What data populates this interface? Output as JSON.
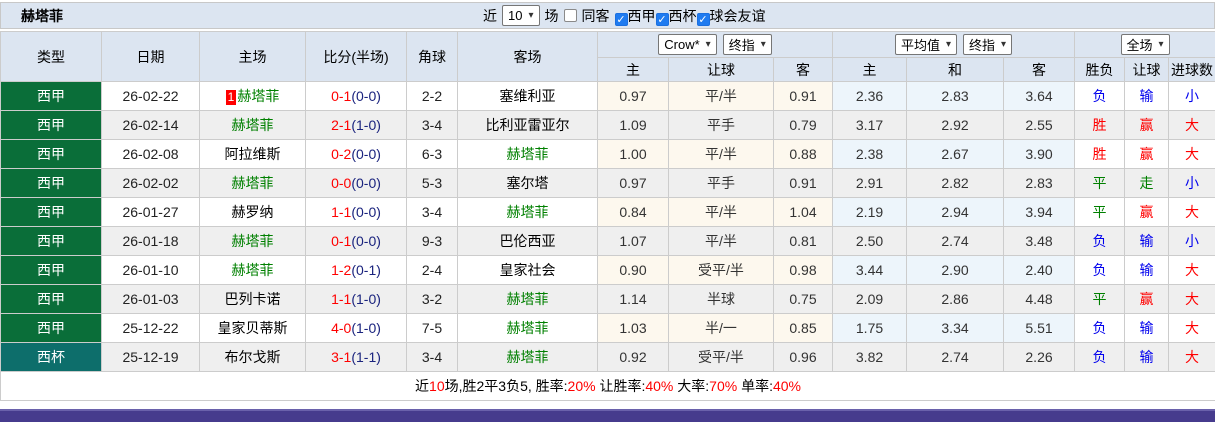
{
  "title": "赫塔菲",
  "toolbar": {
    "near_label": "近",
    "matches_count": "10",
    "matches_label": "场",
    "same_venue_label": "同客",
    "same_venue_checked": false,
    "filters": [
      {
        "label": "西甲",
        "checked": true
      },
      {
        "label": "西杯",
        "checked": true
      },
      {
        "label": "球会友谊",
        "checked": true
      }
    ]
  },
  "header": {
    "static_cols": [
      "类型",
      "日期",
      "主场",
      "比分(半场)",
      "角球",
      "客场"
    ],
    "group1_selects": [
      "Crow*",
      "终指"
    ],
    "group2_selects": [
      "平均值",
      "终指"
    ],
    "group3_selects": [
      "全场"
    ],
    "sub_cols": [
      "主",
      "让球",
      "客",
      "主",
      "和",
      "客",
      "胜负",
      "让球",
      "进球数"
    ]
  },
  "rows": [
    {
      "league": "西甲",
      "league_color": "green",
      "date": "26-02-22",
      "home": "赫塔菲",
      "home_focus": true,
      "home_badge": "1",
      "score": "0-1",
      "half": "(0-0)",
      "corner": "2-2",
      "away": "塞维利亚",
      "away_focus": false,
      "odds": [
        "0.97",
        "平/半",
        "0.91"
      ],
      "avg": [
        "2.36",
        "2.83",
        "3.64"
      ],
      "results": [
        {
          "text": "负",
          "color": "blue"
        },
        {
          "text": "输",
          "color": "blue"
        },
        {
          "text": "小",
          "color": "blue"
        }
      ]
    },
    {
      "league": "西甲",
      "league_color": "green",
      "date": "26-02-14",
      "home": "赫塔菲",
      "home_focus": true,
      "home_badge": "",
      "score": "2-1",
      "half": "(1-0)",
      "corner": "3-4",
      "away": "比利亚雷亚尔",
      "away_focus": false,
      "odds": [
        "1.09",
        "平手",
        "0.79"
      ],
      "avg": [
        "3.17",
        "2.92",
        "2.55"
      ],
      "results": [
        {
          "text": "胜",
          "color": "red"
        },
        {
          "text": "赢",
          "color": "red"
        },
        {
          "text": "大",
          "color": "red"
        }
      ]
    },
    {
      "league": "西甲",
      "league_color": "green",
      "date": "26-02-08",
      "home": "阿拉维斯",
      "home_focus": false,
      "home_badge": "",
      "score": "0-2",
      "half": "(0-0)",
      "corner": "6-3",
      "away": "赫塔菲",
      "away_focus": true,
      "odds": [
        "1.00",
        "平/半",
        "0.88"
      ],
      "avg": [
        "2.38",
        "2.67",
        "3.90"
      ],
      "results": [
        {
          "text": "胜",
          "color": "red"
        },
        {
          "text": "赢",
          "color": "red"
        },
        {
          "text": "大",
          "color": "red"
        }
      ]
    },
    {
      "league": "西甲",
      "league_color": "green",
      "date": "26-02-02",
      "home": "赫塔菲",
      "home_focus": true,
      "home_badge": "",
      "score": "0-0",
      "half": "(0-0)",
      "corner": "5-3",
      "away": "塞尔塔",
      "away_focus": false,
      "odds": [
        "0.97",
        "平手",
        "0.91"
      ],
      "avg": [
        "2.91",
        "2.82",
        "2.83"
      ],
      "results": [
        {
          "text": "平",
          "color": "green"
        },
        {
          "text": "走",
          "color": "green"
        },
        {
          "text": "小",
          "color": "blue"
        }
      ]
    },
    {
      "league": "西甲",
      "league_color": "green",
      "date": "26-01-27",
      "home": "赫罗纳",
      "home_focus": false,
      "home_badge": "",
      "score": "1-1",
      "half": "(0-0)",
      "corner": "3-4",
      "away": "赫塔菲",
      "away_focus": true,
      "odds": [
        "0.84",
        "平/半",
        "1.04"
      ],
      "avg": [
        "2.19",
        "2.94",
        "3.94"
      ],
      "results": [
        {
          "text": "平",
          "color": "green"
        },
        {
          "text": "赢",
          "color": "red"
        },
        {
          "text": "大",
          "color": "red"
        }
      ]
    },
    {
      "league": "西甲",
      "league_color": "green",
      "date": "26-01-18",
      "home": "赫塔菲",
      "home_focus": true,
      "home_badge": "",
      "score": "0-1",
      "half": "(0-0)",
      "corner": "9-3",
      "away": "巴伦西亚",
      "away_focus": false,
      "odds": [
        "1.07",
        "平/半",
        "0.81"
      ],
      "avg": [
        "2.50",
        "2.74",
        "3.48"
      ],
      "results": [
        {
          "text": "负",
          "color": "blue"
        },
        {
          "text": "输",
          "color": "blue"
        },
        {
          "text": "小",
          "color": "blue"
        }
      ]
    },
    {
      "league": "西甲",
      "league_color": "green",
      "date": "26-01-10",
      "home": "赫塔菲",
      "home_focus": true,
      "home_badge": "",
      "score": "1-2",
      "half": "(0-1)",
      "corner": "2-4",
      "away": "皇家社会",
      "away_focus": false,
      "odds": [
        "0.90",
        "受平/半",
        "0.98"
      ],
      "avg": [
        "3.44",
        "2.90",
        "2.40"
      ],
      "results": [
        {
          "text": "负",
          "color": "blue"
        },
        {
          "text": "输",
          "color": "blue"
        },
        {
          "text": "大",
          "color": "red"
        }
      ]
    },
    {
      "league": "西甲",
      "league_color": "green",
      "date": "26-01-03",
      "home": "巴列卡诺",
      "home_focus": false,
      "home_badge": "",
      "score": "1-1",
      "half": "(1-0)",
      "corner": "3-2",
      "away": "赫塔菲",
      "away_focus": true,
      "odds": [
        "1.14",
        "半球",
        "0.75"
      ],
      "avg": [
        "2.09",
        "2.86",
        "4.48"
      ],
      "results": [
        {
          "text": "平",
          "color": "green"
        },
        {
          "text": "赢",
          "color": "red"
        },
        {
          "text": "大",
          "color": "red"
        }
      ]
    },
    {
      "league": "西甲",
      "league_color": "green",
      "date": "25-12-22",
      "home": "皇家贝蒂斯",
      "home_focus": false,
      "home_badge": "",
      "score": "4-0",
      "half": "(1-0)",
      "corner": "7-5",
      "away": "赫塔菲",
      "away_focus": true,
      "odds": [
        "1.03",
        "半/一",
        "0.85"
      ],
      "avg": [
        "1.75",
        "3.34",
        "5.51"
      ],
      "results": [
        {
          "text": "负",
          "color": "blue"
        },
        {
          "text": "输",
          "color": "blue"
        },
        {
          "text": "大",
          "color": "red"
        }
      ]
    },
    {
      "league": "西杯",
      "league_color": "teal",
      "date": "25-12-19",
      "home": "布尔戈斯",
      "home_focus": false,
      "home_badge": "",
      "score": "3-1",
      "half": "(1-1)",
      "corner": "3-4",
      "away": "赫塔菲",
      "away_focus": true,
      "odds": [
        "0.92",
        "受平/半",
        "0.96"
      ],
      "avg": [
        "3.82",
        "2.74",
        "2.26"
      ],
      "results": [
        {
          "text": "负",
          "color": "blue"
        },
        {
          "text": "输",
          "color": "blue"
        },
        {
          "text": "大",
          "color": "red"
        }
      ]
    }
  ],
  "footer": {
    "segments": [
      {
        "text": "近",
        "red": false
      },
      {
        "text": "10",
        "red": true
      },
      {
        "text": "场,胜2平3负5, 胜率:",
        "red": false
      },
      {
        "text": "20%",
        "red": true
      },
      {
        "text": " 让胜率:",
        "red": false
      },
      {
        "text": "40%",
        "red": true
      },
      {
        "text": " 大率:",
        "red": false
      },
      {
        "text": "70%",
        "red": true
      },
      {
        "text": " 单率:",
        "red": false
      },
      {
        "text": "40%",
        "red": true
      }
    ]
  },
  "colors": {
    "header_bg": "#dce5f1",
    "league_green": "#0a6e39",
    "league_teal": "#0d6e6b",
    "focus_team": "#008000",
    "win_red": "#ff0000",
    "loss_blue": "#0000ee",
    "draw_green": "#008000",
    "odds_col_bg": "#fdf8ee",
    "avg_col_bg": "#edf5fb",
    "bottom_bar": "#463b8d"
  }
}
